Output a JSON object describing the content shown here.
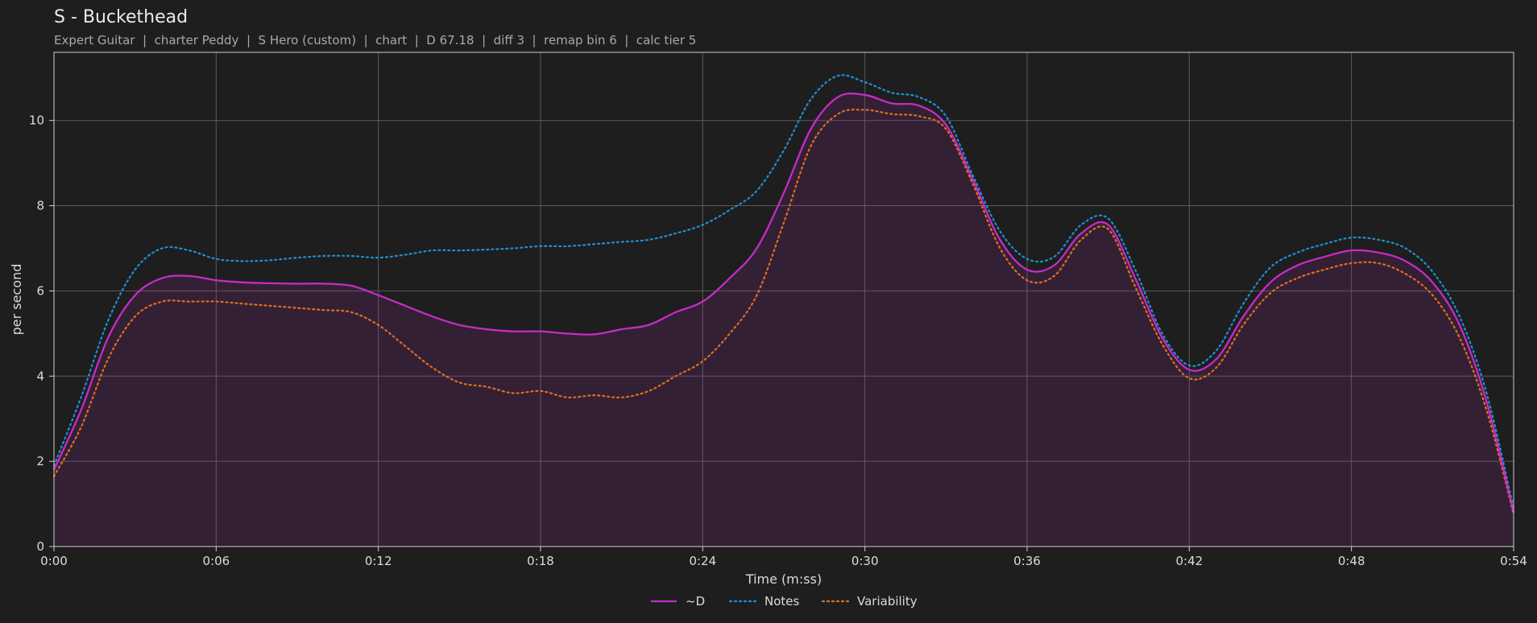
{
  "chart_data": {
    "type": "line",
    "title": "S - Buckethead",
    "subtitle": "Expert Guitar  |  charter Peddy  |  S Hero (custom)  |  chart  |  D 67.18  |  diff 3  |  remap bin 6  |  calc tier 5",
    "xlabel": "Time (m:ss)",
    "ylabel": "per second",
    "xlim": [
      0,
      54
    ],
    "ylim": [
      0,
      11.6
    ],
    "x_ticks": [
      0,
      6,
      12,
      18,
      24,
      30,
      36,
      42,
      48,
      54
    ],
    "x_tick_labels": [
      "0:00",
      "0:06",
      "0:12",
      "0:18",
      "0:24",
      "0:30",
      "0:36",
      "0:42",
      "0:48",
      "0:54"
    ],
    "y_ticks": [
      0,
      2,
      4,
      6,
      8,
      10
    ],
    "y_tick_labels": [
      "0",
      "2",
      "4",
      "6",
      "8",
      "10"
    ],
    "grid": true,
    "legend_position": "bottom-center",
    "x": [
      0,
      1,
      2,
      3,
      4,
      5,
      6,
      7,
      8,
      9,
      10,
      11,
      12,
      13,
      14,
      15,
      16,
      17,
      18,
      19,
      20,
      21,
      22,
      23,
      24,
      25,
      26,
      27,
      28,
      29,
      30,
      31,
      32,
      33,
      34,
      35,
      36,
      37,
      38,
      39,
      40,
      41,
      42,
      43,
      44,
      45,
      46,
      47,
      48,
      49,
      50,
      51,
      52,
      53,
      54
    ],
    "series": [
      {
        "name": "~D",
        "color": "#c62bc6",
        "style": "solid",
        "fill": true,
        "values": [
          1.8,
          3.2,
          4.9,
          5.9,
          6.3,
          6.35,
          6.25,
          6.2,
          6.18,
          6.17,
          6.17,
          6.12,
          5.9,
          5.65,
          5.4,
          5.2,
          5.1,
          5.05,
          5.05,
          5.0,
          4.98,
          5.1,
          5.2,
          5.5,
          5.75,
          6.3,
          7.0,
          8.3,
          9.8,
          10.55,
          10.6,
          10.4,
          10.35,
          9.9,
          8.6,
          7.2,
          6.5,
          6.6,
          7.35,
          7.55,
          6.3,
          4.9,
          4.15,
          4.4,
          5.4,
          6.2,
          6.6,
          6.8,
          6.95,
          6.9,
          6.7,
          6.2,
          5.2,
          3.4,
          0.8
        ]
      },
      {
        "name": "Notes",
        "color": "#1f8fd6",
        "style": "dotted",
        "fill": false,
        "values": [
          1.9,
          3.5,
          5.3,
          6.5,
          7.0,
          6.95,
          6.75,
          6.7,
          6.72,
          6.78,
          6.82,
          6.82,
          6.78,
          6.85,
          6.95,
          6.95,
          6.97,
          7.0,
          7.05,
          7.05,
          7.1,
          7.15,
          7.2,
          7.35,
          7.55,
          7.9,
          8.35,
          9.3,
          10.5,
          11.05,
          10.9,
          10.65,
          10.55,
          10.1,
          8.7,
          7.4,
          6.75,
          6.8,
          7.55,
          7.7,
          6.5,
          5.0,
          4.25,
          4.6,
          5.7,
          6.55,
          6.9,
          7.1,
          7.25,
          7.2,
          7.0,
          6.45,
          5.4,
          3.6,
          0.9
        ]
      },
      {
        "name": "Variability",
        "color": "#df6e22",
        "style": "dotted",
        "fill": false,
        "values": [
          1.65,
          2.8,
          4.4,
          5.4,
          5.75,
          5.75,
          5.75,
          5.7,
          5.65,
          5.6,
          5.55,
          5.5,
          5.2,
          4.7,
          4.2,
          3.85,
          3.75,
          3.6,
          3.65,
          3.5,
          3.55,
          3.5,
          3.65,
          4.0,
          4.35,
          5.0,
          5.9,
          7.6,
          9.4,
          10.15,
          10.25,
          10.15,
          10.1,
          9.8,
          8.5,
          7.0,
          6.25,
          6.35,
          7.2,
          7.45,
          6.1,
          4.75,
          3.95,
          4.2,
          5.2,
          5.95,
          6.3,
          6.5,
          6.65,
          6.65,
          6.4,
          5.9,
          4.9,
          3.2,
          0.75
        ]
      }
    ]
  }
}
